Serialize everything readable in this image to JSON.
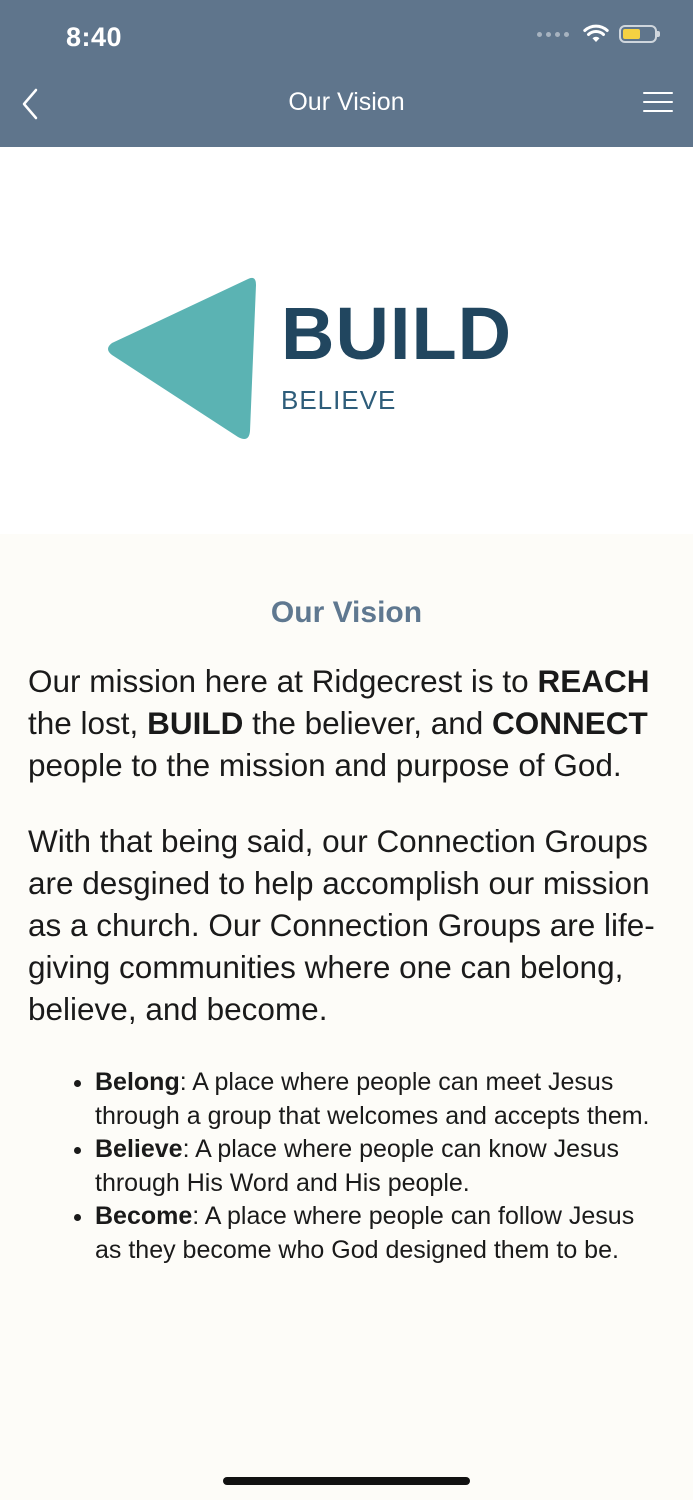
{
  "status_bar": {
    "time": "8:40"
  },
  "nav": {
    "title": "Our Vision"
  },
  "logo": {
    "word": "BUILD",
    "subtitle": "BELIEVE",
    "triangle_color": "#5bb3b3",
    "word_color": "#21465f"
  },
  "content": {
    "heading": "Our Vision",
    "para1": {
      "lead": " Our mission here at Ridgecrest is to ",
      "reach": "REACH",
      "mid1": " the lost, ",
      "build": "BUILD",
      "mid2": " the believer, and ",
      "connect": "CONNECT",
      "tail": " people to the mission and purpose of God."
    },
    "para2": "With that being said, our Connection Groups are desgined to help accomplish our mission as a church. Our Connection Groups are life-giving communities where one can belong, believe, and become.",
    "points": [
      {
        "term": "Belong",
        "text": ": A place where people can meet Jesus through a group that welcomes and accepts them."
      },
      {
        "term": "Believe",
        "text": ": A place where people can know Jesus through His Word and His people."
      },
      {
        "term": "Become",
        "text": ": A place where people can follow Jesus as they become who God designed them to be."
      }
    ]
  },
  "colors": {
    "header_bg": "#5f758c",
    "heading": "#5f7890",
    "page_bg": "#fdfcf8"
  }
}
